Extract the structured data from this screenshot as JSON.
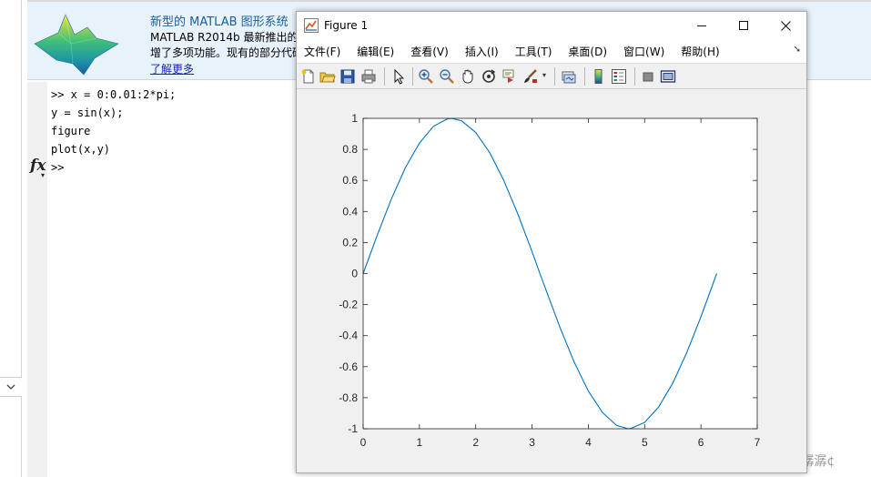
{
  "background": {
    "banner": {
      "title": "新型的 MATLAB 图形系统",
      "line1": "MATLAB R2014b 最新推出的",
      "line2": "增了多项功能。现有的部分代码",
      "link": "了解更多"
    },
    "command_lines": [
      ">> x = 0:0.01:2*pi;",
      "y = sin(x);",
      "figure",
      "plot(x,y)"
    ],
    "prompt": ">>",
    "fx_label": "fx",
    "watermark": "CSDN @『潺潺¢"
  },
  "figure_window": {
    "title": "Figure 1",
    "menu": [
      "文件(F)",
      "编辑(E)",
      "查看(V)",
      "插入(I)",
      "工具(T)",
      "桌面(D)",
      "窗口(W)",
      "帮助(H)"
    ],
    "toolbar_icons": [
      "new-figure-icon",
      "open-file-icon",
      "save-icon",
      "print-icon",
      "edit-plot-icon",
      "zoom-in-icon",
      "zoom-out-icon",
      "pan-icon",
      "rotate-3d-icon",
      "data-cursor-icon",
      "brush-icon",
      "link-plot-icon",
      "colorbar-icon",
      "legend-icon",
      "hide-plot-tools-icon",
      "show-plot-tools-icon"
    ],
    "accent_color": "#0072bd"
  },
  "chart_data": {
    "type": "line",
    "title": "",
    "xlabel": "",
    "ylabel": "",
    "xlim": [
      0,
      7
    ],
    "ylim": [
      -1,
      1
    ],
    "xticks": [
      0,
      1,
      2,
      3,
      4,
      5,
      6,
      7
    ],
    "yticks": [
      -1,
      -0.8,
      -0.6,
      -0.4,
      -0.2,
      0,
      0.2,
      0.4,
      0.6,
      0.8,
      1
    ],
    "ytick_labels": [
      "-1",
      "-0.8",
      "-0.6",
      "-0.4",
      "-0.2",
      "0",
      "0.2",
      "0.4",
      "0.6",
      "0.8",
      "1"
    ],
    "grid": false,
    "series": [
      {
        "color": "#0072bd",
        "x": [
          0,
          0.25,
          0.5,
          0.75,
          1.0,
          1.25,
          1.5,
          1.57,
          1.75,
          2.0,
          2.25,
          2.5,
          2.75,
          3.0,
          3.14,
          3.25,
          3.5,
          3.75,
          4.0,
          4.25,
          4.5,
          4.71,
          4.75,
          5.0,
          5.25,
          5.5,
          5.75,
          6.0,
          6.28
        ],
        "y": [
          0,
          0.247,
          0.479,
          0.682,
          0.841,
          0.949,
          0.997,
          1.0,
          0.984,
          0.909,
          0.778,
          0.598,
          0.382,
          0.141,
          0.0,
          -0.108,
          -0.351,
          -0.572,
          -0.757,
          -0.895,
          -0.978,
          -1.0,
          -0.999,
          -0.959,
          -0.859,
          -0.706,
          -0.508,
          -0.279,
          0.0
        ]
      }
    ]
  }
}
